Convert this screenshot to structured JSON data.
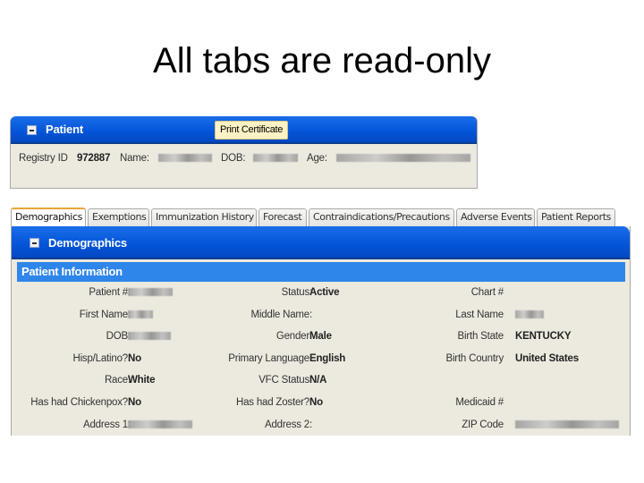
{
  "slide": {
    "title": "All tabs are read-only"
  },
  "patient_panel": {
    "title": "Patient",
    "print_button": "Print Certificate",
    "registry_id_label": "Registry ID",
    "registry_id": "972887",
    "name_label": "Name:",
    "name_value": "[redacted]",
    "dob_label": "DOB:",
    "dob_value": "[redacted]",
    "age_label": "Age:",
    "age_value": "[redacted]"
  },
  "tabs": [
    {
      "label": "Demographics",
      "active": true
    },
    {
      "label": "Exemptions",
      "active": false
    },
    {
      "label": "Immunization History",
      "active": false
    },
    {
      "label": "Forecast",
      "active": false
    },
    {
      "label": "Contraindications/Precautions",
      "active": false
    },
    {
      "label": "Adverse Events",
      "active": false
    },
    {
      "label": "Patient Reports",
      "active": false
    }
  ],
  "demographics": {
    "title": "Demographics",
    "section_title": "Patient Information",
    "rows": [
      [
        {
          "label": "Patient #:",
          "value": ""
        },
        {
          "label": "Status:",
          "value": "Active"
        },
        {
          "label": "Chart #",
          "value": ""
        }
      ],
      [
        {
          "label": "First Name:",
          "value": ""
        },
        {
          "label": "Middle Name:",
          "value": ""
        },
        {
          "label": "Last Name",
          "value": ""
        }
      ],
      [
        {
          "label": "DOB:",
          "value": ""
        },
        {
          "label": "Gender:",
          "value": "Male"
        },
        {
          "label": "Birth State",
          "value": "KENTUCKY"
        }
      ],
      [
        {
          "label": "Hisp/Latino?:",
          "value": "No"
        },
        {
          "label": "Primary Language:",
          "value": "English"
        },
        {
          "label": "Birth Country",
          "value": "United States"
        }
      ],
      [
        {
          "label": "Race:",
          "value": "White"
        },
        {
          "label": "VFC Status:",
          "value": "N/A"
        },
        {
          "label": "",
          "value": ""
        }
      ],
      [
        {
          "label": "Has had Chickenpox?:",
          "value": "No"
        },
        {
          "label": "Has had Zoster?:",
          "value": "No"
        },
        {
          "label": "Medicaid #",
          "value": ""
        }
      ],
      [
        {
          "label": "Address 1:",
          "value": ""
        },
        {
          "label": "Address 2:",
          "value": ""
        },
        {
          "label": "ZIP Code",
          "value": ""
        }
      ]
    ],
    "redacted_fields": [
      "Patient #",
      "First Name",
      "Last Name",
      "DOB",
      "Address 1",
      "ZIP Code"
    ]
  }
}
